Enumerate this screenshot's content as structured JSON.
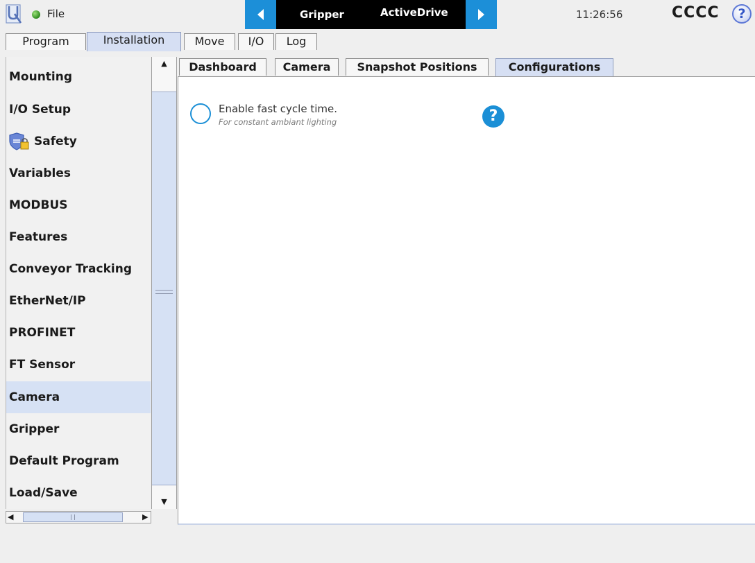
{
  "header": {
    "file_label": "File",
    "nav_primary": "Gripper",
    "nav_secondary": "ActiveDrive",
    "clock": "11:26:56",
    "robot_name": "CCCC",
    "help_glyph": "?"
  },
  "main_tabs": [
    {
      "label": "Program",
      "active": false
    },
    {
      "label": "Installation",
      "active": true
    },
    {
      "label": "Move",
      "active": false
    },
    {
      "label": "I/O",
      "active": false
    },
    {
      "label": "Log",
      "active": false
    }
  ],
  "sidebar": {
    "items": [
      {
        "label": "Mounting"
      },
      {
        "label": "I/O Setup"
      },
      {
        "label": "Safety",
        "icon": "shield-lock-icon"
      },
      {
        "label": "Variables"
      },
      {
        "label": "MODBUS"
      },
      {
        "label": "Features"
      },
      {
        "label": "Conveyor Tracking"
      },
      {
        "label": "EtherNet/IP"
      },
      {
        "label": "PROFINET"
      },
      {
        "label": "FT Sensor"
      },
      {
        "label": "Camera",
        "selected": true
      },
      {
        "label": "Gripper"
      },
      {
        "label": "Default Program"
      },
      {
        "label": "Load/Save"
      }
    ]
  },
  "sub_tabs": [
    {
      "label": "Dashboard",
      "active": false
    },
    {
      "label": "Camera",
      "active": false
    },
    {
      "label": "Snapshot Positions",
      "active": false
    },
    {
      "label": "Configurations",
      "active": true
    }
  ],
  "configurations": {
    "fast_cycle_label": "Enable fast cycle time.",
    "fast_cycle_hint": "For constant ambiant lighting",
    "fast_cycle_checked": false,
    "help_glyph": "?"
  },
  "colors": {
    "accent_blue": "#1b8fd6",
    "selected_bg": "#d6e1f4",
    "nav_center_bg": "#000000"
  }
}
